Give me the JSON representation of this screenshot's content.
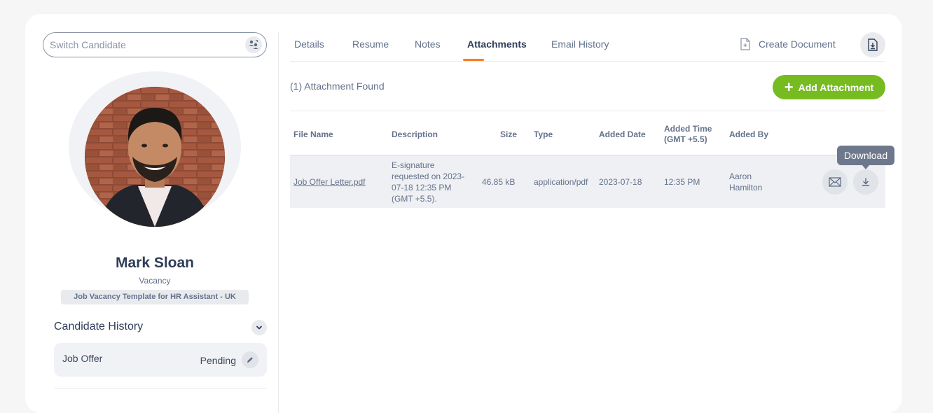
{
  "search": {
    "placeholder": "Switch Candidate"
  },
  "candidate": {
    "name": "Mark Sloan",
    "vacancy_label": "Vacancy",
    "vacancy": "Job Vacancy Template for HR Assistant - UK"
  },
  "history": {
    "title": "Candidate History",
    "items": [
      {
        "label": "Job Offer",
        "status": "Pending"
      }
    ]
  },
  "tabs": [
    {
      "label": "Details"
    },
    {
      "label": "Resume"
    },
    {
      "label": "Notes"
    },
    {
      "label": "Attachments",
      "active": true
    },
    {
      "label": "Email History"
    }
  ],
  "toolbar": {
    "create_document": "Create Document"
  },
  "attachments": {
    "found_text": "(1) Attachment Found",
    "add_label": "Add Attachment",
    "columns": {
      "file_name": "File Name",
      "description": "Description",
      "size": "Size",
      "type": "Type",
      "added_date": "Added Date",
      "added_time_1": "Added Time",
      "added_time_2": "(GMT +5.5)",
      "added_by": "Added By"
    },
    "rows": [
      {
        "file_name": "Job Offer Letter.pdf",
        "description": [
          "E-signature",
          "requested on 2023-",
          "07-18 12:35 PM",
          "(GMT +5.5)."
        ],
        "size": "46.85 kB",
        "type": "application/pdf",
        "added_date": "2023-07-18",
        "added_time": "12:35 PM",
        "added_by": [
          "Aaron",
          "Hamilton"
        ]
      }
    ],
    "tooltip": "Download"
  },
  "colors": {
    "accent": "#ff7b1d",
    "primary_button": "#76bc21",
    "heading": "#2f3d58",
    "text": "#64728c"
  },
  "icons": [
    "switch-candidate-icon",
    "chevron-down-icon",
    "pencil-icon",
    "file-add-icon",
    "download-icon",
    "mail-icon",
    "plus-icon"
  ]
}
